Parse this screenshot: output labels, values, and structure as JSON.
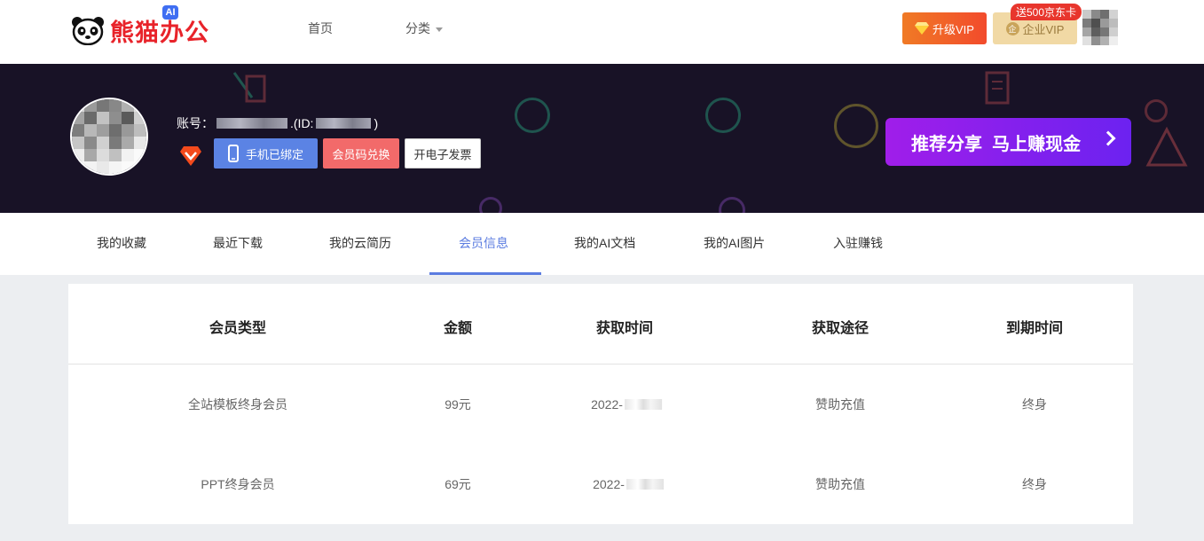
{
  "header": {
    "logo_text": "熊猫办公",
    "logo_badge": "AI",
    "nav": [
      {
        "label": "首页"
      },
      {
        "label": "分类"
      }
    ],
    "vip_button": "升级VIP",
    "enterprise_button": "企业VIP",
    "enterprise_badge": "送500京东卡",
    "coin_glyph": "企"
  },
  "profile": {
    "account_prefix": "账号：",
    "id_prefix": ".(ID:",
    "id_suffix": ")",
    "phone_button": "手机已绑定",
    "code_button": "会员码兑换",
    "invoice_button": "开电子发票",
    "share_button": "推荐分享  马上赚现金"
  },
  "tabs": [
    {
      "label": "我的收藏"
    },
    {
      "label": "最近下载"
    },
    {
      "label": "我的云简历"
    },
    {
      "label": "会员信息",
      "active": true
    },
    {
      "label": "我的AI文档"
    },
    {
      "label": "我的AI图片"
    },
    {
      "label": "入驻赚钱"
    }
  ],
  "table": {
    "headers": [
      "会员类型",
      "金额",
      "获取时间",
      "获取途径",
      "到期时间"
    ],
    "rows": [
      {
        "type": "全站模板终身会员",
        "amount": "99元",
        "time": "2022-",
        "source": "赞助充值",
        "expiry": "终身"
      },
      {
        "type": "PPT终身会员",
        "amount": "69元",
        "time": "2022-",
        "source": "赞助充值",
        "expiry": "终身"
      }
    ]
  },
  "colors": {
    "accent": "#5b7ce0",
    "brand_red": "#e8232a",
    "banner_bg": "#181226"
  }
}
